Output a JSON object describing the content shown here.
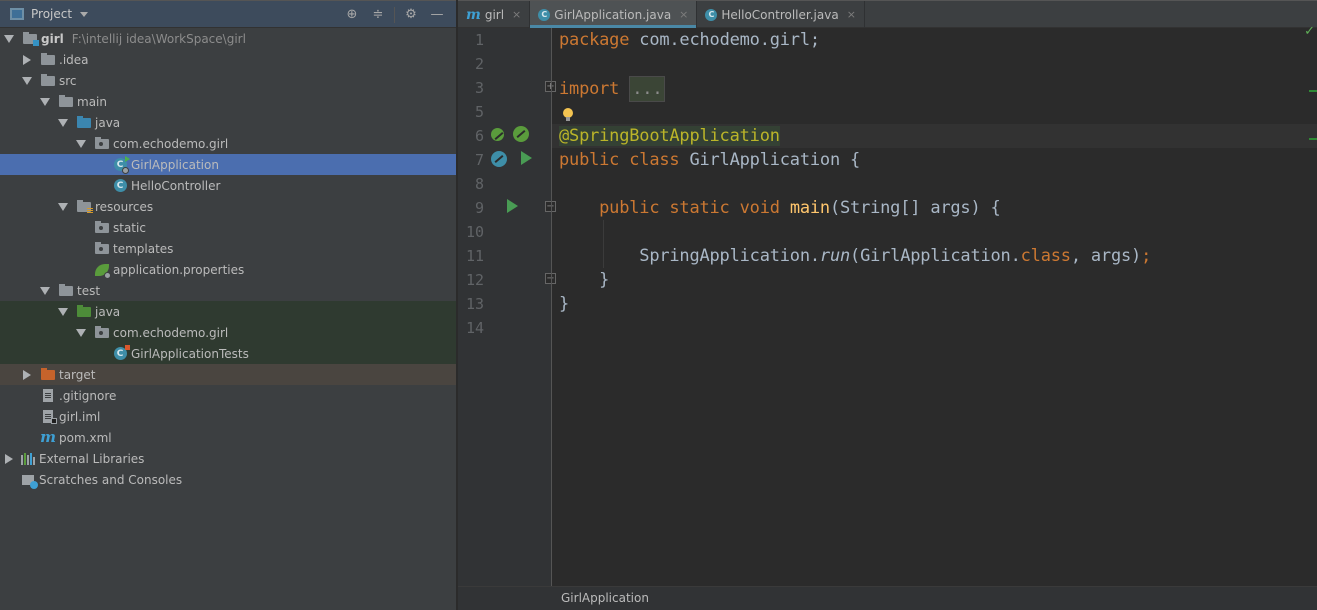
{
  "project_panel": {
    "title": "Project",
    "tools": [
      {
        "name": "locate-icon",
        "glyph": "⊕"
      },
      {
        "name": "collapse-all-icon",
        "glyph": "≑"
      },
      {
        "name": "settings-icon",
        "glyph": "⚙"
      },
      {
        "name": "hide-icon",
        "glyph": "—"
      }
    ],
    "tree": [
      {
        "label": "girl",
        "hint": "F:\\intellij idea\\WorkSpace\\girl",
        "depth": 0,
        "expanded": true,
        "icon": "module-folder-icon"
      },
      {
        "label": ".idea",
        "depth": 1,
        "expanded": false,
        "icon": "folder-icon"
      },
      {
        "label": "src",
        "depth": 1,
        "expanded": true,
        "icon": "folder-icon"
      },
      {
        "label": "main",
        "depth": 2,
        "expanded": true,
        "icon": "folder-icon"
      },
      {
        "label": "java",
        "depth": 3,
        "expanded": true,
        "icon": "source-folder-icon"
      },
      {
        "label": "com.echodemo.girl",
        "depth": 4,
        "expanded": true,
        "icon": "package-icon"
      },
      {
        "label": "GirlApplication",
        "depth": 5,
        "icon": "spring-boot-class-icon",
        "selected": true
      },
      {
        "label": "HelloController",
        "depth": 5,
        "icon": "class-icon"
      },
      {
        "label": "resources",
        "depth": 3,
        "expanded": true,
        "icon": "resources-folder-icon"
      },
      {
        "label": "static",
        "depth": 4,
        "icon": "package-icon"
      },
      {
        "label": "templates",
        "depth": 4,
        "icon": "package-icon"
      },
      {
        "label": "application.properties",
        "depth": 4,
        "icon": "spring-properties-icon"
      },
      {
        "label": "test",
        "depth": 2,
        "expanded": true,
        "icon": "folder-icon"
      },
      {
        "label": "java",
        "depth": 3,
        "expanded": true,
        "icon": "test-folder-icon"
      },
      {
        "label": "com.echodemo.girl",
        "depth": 4,
        "expanded": true,
        "icon": "package-icon"
      },
      {
        "label": "GirlApplicationTests",
        "depth": 5,
        "icon": "test-class-icon"
      },
      {
        "label": "target",
        "depth": 1,
        "expanded": false,
        "icon": "excluded-folder-icon"
      },
      {
        "label": ".gitignore",
        "depth": 1,
        "icon": "text-file-icon"
      },
      {
        "label": "girl.iml",
        "depth": 1,
        "icon": "iml-file-icon"
      },
      {
        "label": "pom.xml",
        "depth": 1,
        "icon": "maven-icon"
      },
      {
        "label": "External Libraries",
        "depth": 0,
        "expanded": false,
        "icon": "libraries-icon"
      },
      {
        "label": "Scratches and Consoles",
        "depth": 0,
        "icon": "scratches-icon"
      }
    ]
  },
  "editor": {
    "tabs": [
      {
        "label": "girl",
        "icon": "maven-icon",
        "active": false
      },
      {
        "label": "GirlApplication.java",
        "icon": "spring-boot-class-icon",
        "active": true
      },
      {
        "label": "HelloController.java",
        "icon": "class-icon",
        "active": false
      }
    ],
    "close_glyph": "×",
    "line_numbers": [
      "1",
      "2",
      "3",
      "5",
      "6",
      "7",
      "8",
      "9",
      "10",
      "11",
      "12",
      "13",
      "14"
    ],
    "code": {
      "l1_kw": "package",
      "l1_rest": " com.echodemo.girl;",
      "l3_kw": "import",
      "l3_fold": "...",
      "l6_ann": "@SpringBootApplication",
      "l7_kw": "public class",
      "l7_rest": " GirlApplication {",
      "l9_indent": "    ",
      "l9_kw": "public static void",
      "l9_fn": "main",
      "l9_rest": "(String[] args) {",
      "l11_pre": "        SpringApplication.",
      "l11_run": "run",
      "l11_mid": "(GirlApplication.",
      "l11_kw": "class",
      "l11_post": ", args)",
      "l11_semi": ";",
      "l12": "    }",
      "l13": "}"
    },
    "fold_plus": "+",
    "fold_minus": "−",
    "inspection_ok": "✓",
    "breadcrumb": "GirlApplication"
  }
}
